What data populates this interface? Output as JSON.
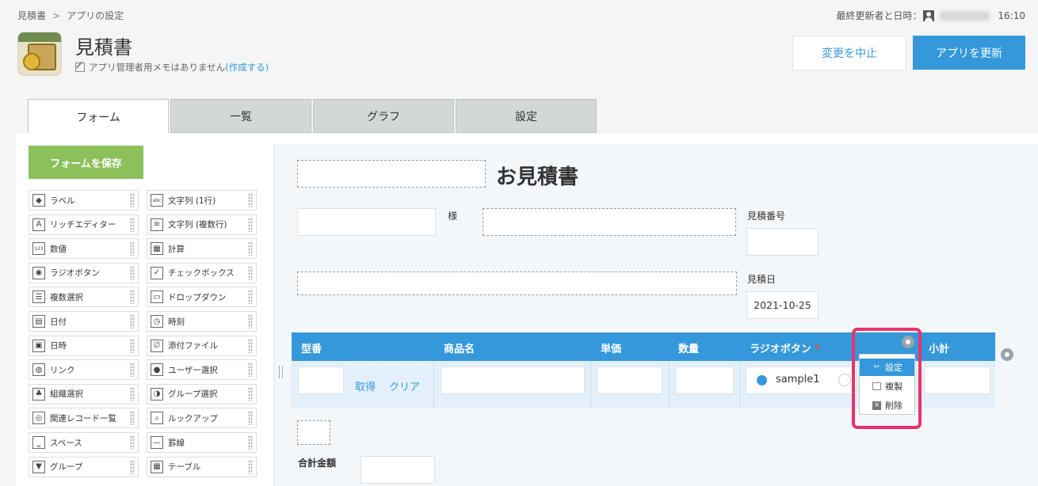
{
  "breadcrumb": {
    "root": "見積書",
    "separator": ">",
    "current": "アプリの設定"
  },
  "updated": {
    "label": "最終更新者と日時：",
    "time": "16:10"
  },
  "app": {
    "title": "見積書",
    "memo_text": "アプリ管理者用メモはありません",
    "memo_link": "(作成する)"
  },
  "buttons": {
    "cancel": "変更を中止",
    "update": "アプリを更新",
    "save_form": "フォームを保存"
  },
  "tabs": [
    "フォーム",
    "一覧",
    "グラフ",
    "設定"
  ],
  "palette": [
    {
      "label": "ラベル",
      "icon": "tag-icon"
    },
    {
      "label": "文字列 (1行)",
      "icon": "abc-icon"
    },
    {
      "label": "リッチエディター",
      "icon": "text-a-icon"
    },
    {
      "label": "文字列 (複数行)",
      "icon": "multiline-icon"
    },
    {
      "label": "数値",
      "icon": "number-123-icon"
    },
    {
      "label": "計算",
      "icon": "calculator-icon"
    },
    {
      "label": "ラジオボタン",
      "icon": "radio-icon"
    },
    {
      "label": "チェックボックス",
      "icon": "checkbox-icon"
    },
    {
      "label": "複数選択",
      "icon": "list-icon"
    },
    {
      "label": "ドロップダウン",
      "icon": "dropdown-icon"
    },
    {
      "label": "日付",
      "icon": "calendar-icon"
    },
    {
      "label": "時刻",
      "icon": "clock-icon"
    },
    {
      "label": "日時",
      "icon": "calendar-time-icon"
    },
    {
      "label": "添付ファイル",
      "icon": "paperclip-icon"
    },
    {
      "label": "リンク",
      "icon": "globe-icon"
    },
    {
      "label": "ユーザー選択",
      "icon": "user-icon"
    },
    {
      "label": "組織選択",
      "icon": "org-icon"
    },
    {
      "label": "グループ選択",
      "icon": "group-icon"
    },
    {
      "label": "関連レコード一覧",
      "icon": "related-records-icon"
    },
    {
      "label": "ルックアップ",
      "icon": "lookup-icon"
    },
    {
      "label": "スペース",
      "icon": "space-icon"
    },
    {
      "label": "罫線",
      "icon": "line-icon"
    },
    {
      "label": "グループ",
      "icon": "group-field-icon"
    },
    {
      "label": "テーブル",
      "icon": "table-icon"
    }
  ],
  "form": {
    "title": "お見積書",
    "honorific": "様",
    "estimate_number_label": "見積番号",
    "estimate_date_label": "見積日",
    "estimate_date_value": "2021-10-25",
    "total_label": "合計金額",
    "table": {
      "headers": [
        "型番",
        "商品名",
        "単価",
        "数量",
        "ラジオボタン",
        "小計"
      ],
      "required_mark": "*",
      "get_link": "取得",
      "clear_link": "クリア",
      "radio_option": "sample1"
    }
  },
  "context_menu": {
    "settings": "設定",
    "duplicate": "複製",
    "delete": "削除"
  },
  "colors": {
    "accent": "#3498db",
    "save": "#8cc05b",
    "highlight": "#e8336d",
    "required": "#e74c3c"
  }
}
